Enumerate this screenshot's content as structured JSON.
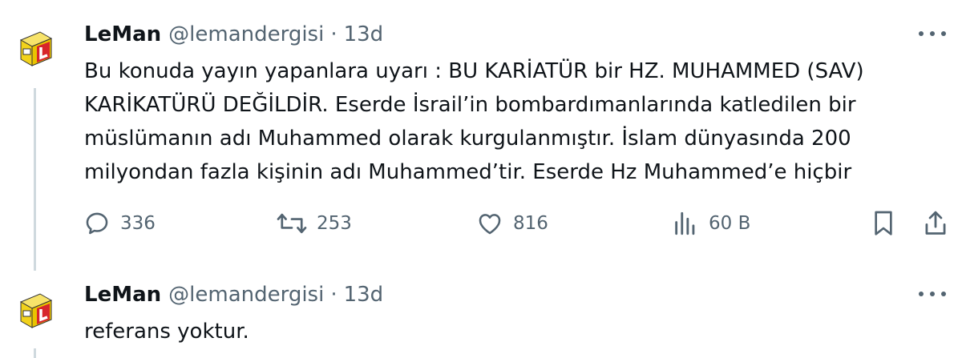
{
  "tweets": [
    {
      "author_name": "LeMan",
      "handle": "@lemandergisi",
      "separator": "·",
      "time": "13d",
      "text_lines": [
        "Bu konuda yayın yapanlara uyarı : BU KARİATÜR bir HZ. MUHAMMED (SAV)",
        "KARİKATÜRÜ DEĞİLDİR. Eserde İsrail’in bombardımanlarında katledilen bir",
        "müslümanın adı Muhammed olarak kurgulanmıştır. İslam dünyasında 200",
        "milyondan fazla kişinin adı Muhammed’tir. Eserde Hz Muhammed’e hiçbir"
      ],
      "actions": {
        "replies": "336",
        "reposts": "253",
        "likes": "816",
        "views": "60 B"
      }
    },
    {
      "author_name": "LeMan",
      "handle": "@lemandergisi",
      "separator": "·",
      "time": "13d",
      "text_lines": [
        "referans yoktur."
      ]
    }
  ],
  "icons": {
    "avatar": "leman-logo-avatar",
    "more": "more-horizontal-icon",
    "reply": "reply-icon",
    "repost": "repost-icon",
    "like": "heart-icon",
    "views": "views-chart-icon",
    "bookmark": "bookmark-icon",
    "share": "share-icon"
  },
  "colors": {
    "text": "#0f1419",
    "secondary": "#536471",
    "thread_line": "#cfd9de",
    "logo_yellow": "#f2d21b",
    "logo_red": "#d7262b"
  }
}
